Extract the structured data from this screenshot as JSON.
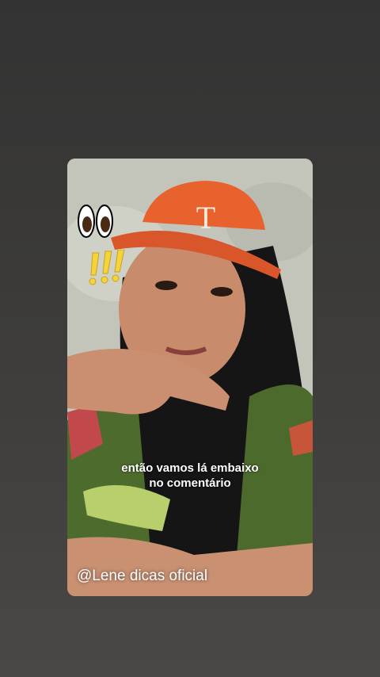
{
  "story": {
    "caption_line1": "então vamos lá embaixo",
    "caption_line2": "no comentário",
    "handle": "@Lene dicas oficial"
  },
  "stickers": {
    "eyes": "eyes-icon",
    "exclamation": "exclamation-marks-icon"
  },
  "colors": {
    "cap": "#e8622d",
    "exclaim": "#f5d43a"
  }
}
